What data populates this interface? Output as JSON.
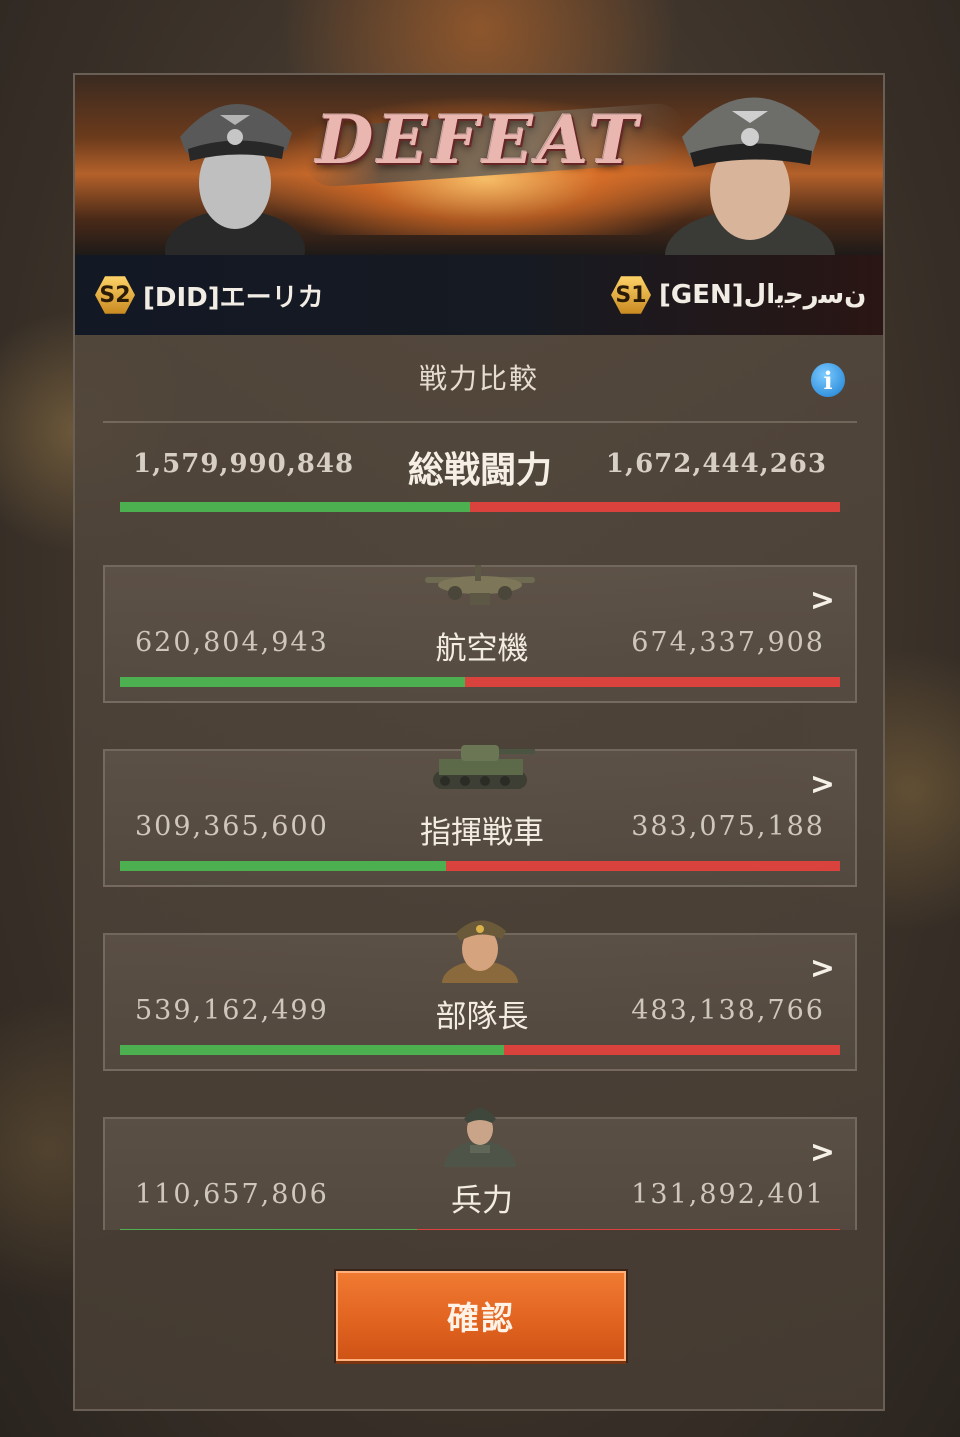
{
  "result": {
    "title": "DEFEAT"
  },
  "players": {
    "left": {
      "server": "S2",
      "name": "[DID]エーリカ"
    },
    "right": {
      "server": "S1",
      "name": "[GEN]ﻥﺳﺭﺟﻳﺍﻝ"
    }
  },
  "comparison": {
    "title": "戦力比較",
    "total": {
      "label": "総戦闘力",
      "left": "1,579,990,848",
      "right": "1,672,444,263",
      "left_ratio": 0.486
    },
    "categories": [
      {
        "label": "航空機",
        "icon": "aircraft-icon",
        "left": "620,804,943",
        "right": "674,337,908",
        "left_ratio": 0.479
      },
      {
        "label": "指揮戦車",
        "icon": "tank-icon",
        "left": "309,365,600",
        "right": "383,075,188",
        "left_ratio": 0.453
      },
      {
        "label": "部隊長",
        "icon": "commander-portrait-icon",
        "left": "539,162,499",
        "right": "483,138,766",
        "left_ratio": 0.534
      },
      {
        "label": "兵力",
        "icon": "soldier-icon",
        "left": "110,657,806",
        "right": "131,892,401",
        "left_ratio": 0.412
      }
    ]
  },
  "confirm_label": "確認",
  "colors": {
    "left_bar": "#4caf50",
    "right_bar": "#d9423d",
    "button": "#e0621f"
  }
}
